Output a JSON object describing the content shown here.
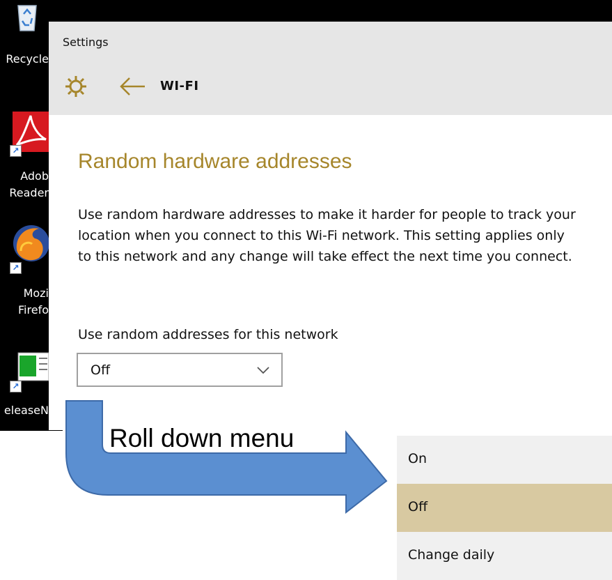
{
  "desktop": {
    "icons": [
      {
        "label": "Recycle",
        "icon": "recycle-bin-icon"
      },
      {
        "label": "Adob",
        "label2": "Reader",
        "icon": "adobe-reader-icon"
      },
      {
        "label": "Mozi",
        "label2": "Firefo",
        "icon": "firefox-icon"
      },
      {
        "label": "eleaseN",
        "icon": "release-notes-icon"
      }
    ]
  },
  "window": {
    "title": "Settings",
    "page_name": "WI-FI",
    "gear_icon": "gear-icon",
    "back_icon": "back-arrow-icon",
    "accent_color": "#a6862b"
  },
  "content": {
    "heading": "Random hardware addresses",
    "description": "Use random hardware addresses to make it harder for people to track your location when you connect to this Wi-Fi network. This setting applies only to this network and any change will take effect the next time you connect.",
    "select_label": "Use random addresses for this network",
    "select_value": "Off"
  },
  "annotation": {
    "label": "Roll down menu",
    "arrow_color": "#5b8fd1"
  },
  "dropdown": {
    "options": [
      {
        "label": "On",
        "selected": false
      },
      {
        "label": "Off",
        "selected": true
      },
      {
        "label": "Change daily",
        "selected": false
      }
    ],
    "selected_color": "#d8c9a1"
  }
}
